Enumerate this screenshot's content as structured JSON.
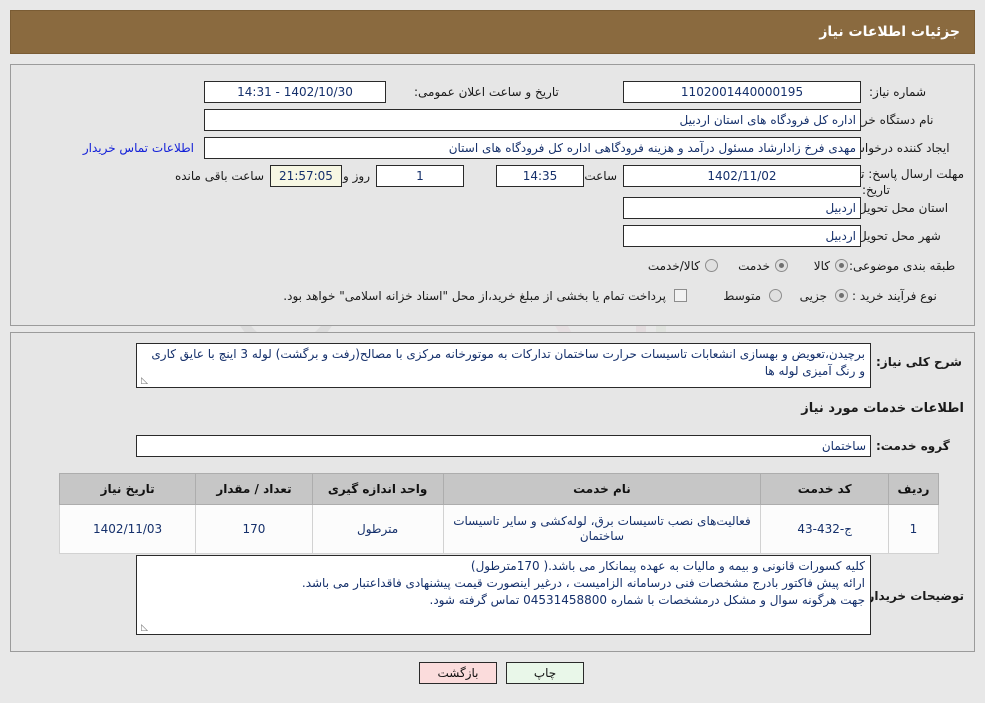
{
  "header": {
    "title": "جزئیات اطلاعات نیاز"
  },
  "info": {
    "need_number_label": "شماره نیاز:",
    "need_number_value": "1102001440000195",
    "announce_label": "تاریخ و ساعت اعلان عمومی:",
    "announce_value": "1402/10/30 - 14:31",
    "buyer_org_label": "نام دستگاه خریدار:",
    "buyer_org_value": "اداره کل فرودگاه های استان اردبیل",
    "creator_label": "ایجاد کننده درخواست:",
    "creator_value": "مهدی فرخ زادارشاد مسئول درآمد و هزینه فرودگاهی اداره کل فرودگاه های استان",
    "creator_link": "اطلاعات تماس خریدار",
    "deadline_label_line1": "مهلت ارسال پاسخ: تا",
    "deadline_label_line2": "تاریخ:",
    "deadline_date": "1402/11/02",
    "hour_label": "ساعت",
    "deadline_time": "14:35",
    "days_value": "1",
    "days_label": "روز و",
    "countdown_value": "21:57:05",
    "remaining_label": "ساعت باقی مانده",
    "province_label": "استان محل تحویل:",
    "province_value": "اردبیل",
    "city_label": "شهر محل تحویل:",
    "city_value": "اردبیل",
    "category_label": "طبقه بندی موضوعی:",
    "category_options": [
      "کالا",
      "خدمت",
      "کالا/خدمت"
    ],
    "category_selected": "خدمت",
    "process_label": "نوع فرآیند خرید :",
    "process_options": [
      "جزیی",
      "متوسط"
    ],
    "process_selected": "جزیی",
    "treasury_note": "پرداخت تمام یا بخشی از مبلغ خرید،از محل \"اسناد خزانه اسلامی\" خواهد بود."
  },
  "description": {
    "label": "شرح کلی نیاز:",
    "text": "برچیدن،تعویض و بهسازی انشعابات تاسیسات حرارت ساختمان تدارکات به موتورخانه مرکزی با مصالح(رفت و برگشت) لوله 3 اینچ با عایق کاری و رنگ آمیزی لوله ها",
    "services_section_title": "اطلاعات خدمات مورد نیاز",
    "service_group_label": "گروه خدمت:",
    "service_group_value": "ساختمان"
  },
  "table": {
    "headers": [
      "ردیف",
      "کد خدمت",
      "نام خدمت",
      "واحد اندازه گیری",
      "تعداد / مقدار",
      "تاریخ نیاز"
    ],
    "rows": [
      {
        "index": "1",
        "code": "ج-432-43",
        "name": "فعالیت‌های نصب تاسیسات برق، لوله‌کشی و سایر تاسیسات ساختمان",
        "unit": "مترطول",
        "qty": "170",
        "date": "1402/11/03"
      }
    ]
  },
  "notes": {
    "label": "توضیحات خریدار:",
    "lines": [
      "کلیه کسورات قانونی و بیمه و مالیات به عهده پیمانکار می باشد.( 170مترطول)",
      "ارائه پیش فاکتور بادرج مشخصات فنی درسامانه الزامیست ، درغیر اینصورت قیمت پیشنهادی فاقداعتبار می باشد.",
      "جهت هرگونه سوال و مشکل درمشخصات با شماره 04531458800 تماس گرفته شود."
    ]
  },
  "footer": {
    "print_label": "چاپ",
    "back_label": "بازگشت"
  },
  "watermark": {
    "text": "AriaTender.net"
  },
  "colors": {
    "header_bg": "#8a6a3f",
    "link": "#1320d8",
    "field_text": "#15306b",
    "print_btn": "#e9f7e9",
    "back_btn": "#fbdcdc",
    "table_header": "#c6c6c6"
  }
}
